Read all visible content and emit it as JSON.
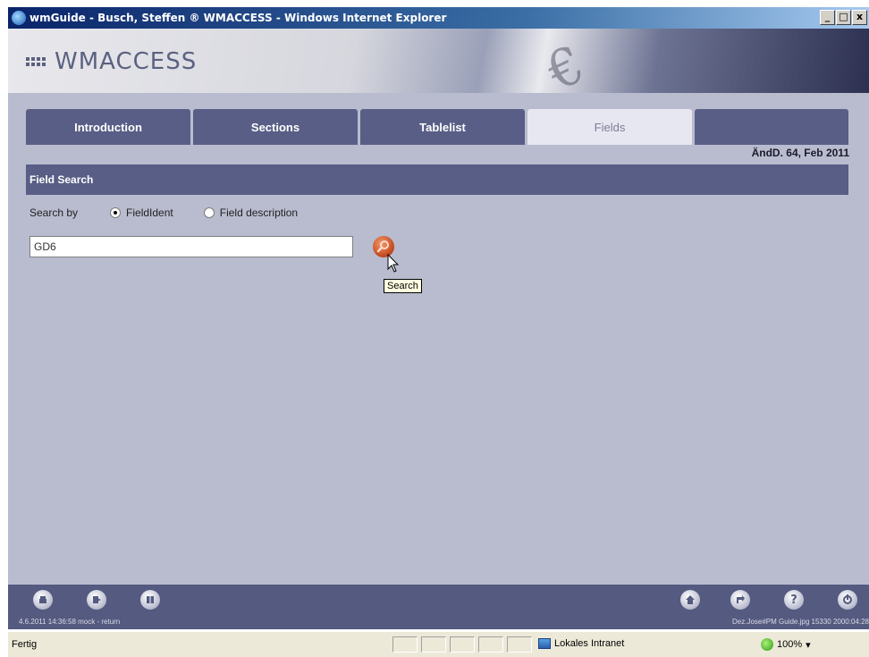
{
  "window": {
    "title": "wmGuide - Busch, Steffen ® WMACCESS - Windows Internet Explorer",
    "controls": [
      "_",
      "□",
      "x"
    ]
  },
  "banner": {
    "logo_text": "WMACCESS"
  },
  "tabs": [
    {
      "label": "Introduction",
      "active": false
    },
    {
      "label": "Sections",
      "active": false
    },
    {
      "label": "Tablelist",
      "active": false
    },
    {
      "label": "Fields",
      "active": true
    },
    {
      "label": "",
      "active": false
    }
  ],
  "release_info": "ÄndD. 64, Feb 2011",
  "field_search": {
    "header": "Field Search",
    "search_by_label": "Search by",
    "options": [
      {
        "label": "FieldIdent",
        "checked": true
      },
      {
        "label": "Field description",
        "checked": false
      }
    ],
    "input_value": "GD6",
    "search_tooltip": "Search"
  },
  "footer": {
    "left_buttons": [
      "print-icon",
      "export-icon",
      "book-icon"
    ],
    "right_buttons": [
      "home-icon",
      "navigate-icon",
      "help-icon",
      "exit-icon"
    ],
    "status_left": "4.6.2011 14:36:58 mock - return",
    "status_right": "Dez.Jose#PM Guide.jpg 15330 2000:04:28"
  },
  "ie_status": {
    "text": "Fertig",
    "zone": "Lokales Intranet",
    "zoom": "100%"
  }
}
